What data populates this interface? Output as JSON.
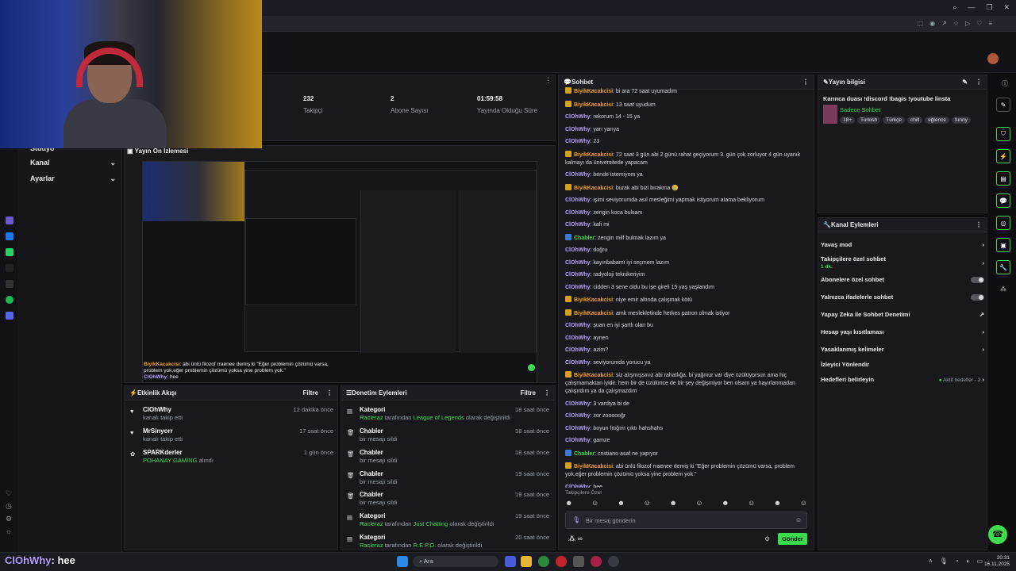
{
  "stats": [
    {
      "value": "232",
      "label": "Takipçi"
    },
    {
      "value": "2",
      "label": "Abone Sayısı"
    },
    {
      "value": "01:59:58",
      "label": "Yayında Olduğu Süre"
    }
  ],
  "sidebar": {
    "studio": "Stüdyo",
    "items": [
      {
        "label": "Kanal"
      },
      {
        "label": "Ayarlar"
      }
    ]
  },
  "preview": {
    "title": "Yayın Ön İzlemesi",
    "overlay_user": "BiyikKacakcisi",
    "overlay_text": ": abi ünlü filozof rraenee demiş ki \"Eğer problemin çözümü varsa, problem yok,eğer problemin çözümü yoksa yine problem yok.\"",
    "overlay_user2": "ClOhWhy",
    "overlay_text2": ": hee"
  },
  "activity": {
    "title": "Etkinlik Akışı",
    "filter": "Filtre",
    "items": [
      {
        "user": "ClOhWhy",
        "desc": "kanalı takip etti",
        "time": "12 dakika önce"
      },
      {
        "user": "MrSinyorr",
        "desc": "kanalı takip etti",
        "time": "17 saat önce"
      },
      {
        "user": "SPARKderler",
        "desc_green": "POHANAY GAMİNG",
        "desc": "alındı",
        "time": "1 gün önce"
      }
    ]
  },
  "moderation": {
    "title": "Denetim Eylemleri",
    "filter": "Filtre",
    "items": [
      {
        "title": "Kategori",
        "by": "Racleraz",
        "mid": "tarafından",
        "target": "League of Legends",
        "end": "olarak değiştirildi",
        "time": "18 saat önce"
      },
      {
        "title": "Chabler",
        "desc": "bir mesajı sildi",
        "time": "18 saat önce"
      },
      {
        "title": "Chabler",
        "desc": "bir mesajı sildi",
        "time": "18 saat önce"
      },
      {
        "title": "Chabler",
        "desc": "bir mesajı sildi",
        "time": "19 saat önce"
      },
      {
        "title": "Chabler",
        "desc": "bir mesajı sildi",
        "time": "19 saat önce"
      },
      {
        "title": "Kategori",
        "by": "Racleraz",
        "mid": "tarafından",
        "target": "Just Chatting",
        "end": "olarak değiştirildi",
        "time": "19 saat önce"
      },
      {
        "title": "Kategori",
        "by": "Racleraz",
        "mid": "tarafından",
        "target": "R.E.P.O.",
        "end": "olarak değiştirildi",
        "time": "20 saat önce"
      }
    ]
  },
  "chat": {
    "title": "Sohbet",
    "messages": [
      {
        "u": "BiyikKacakcisi",
        "c": "o",
        "t": ": bi ara 72 saat uyumadım"
      },
      {
        "u": "BiyikKacakcisi",
        "c": "o",
        "t": ": 13 saat uyudum"
      },
      {
        "u": "ClOhWhy",
        "c": "v",
        "t": ": rekorum 14 - 15 ya"
      },
      {
        "u": "ClOhWhy",
        "c": "v",
        "t": ": yarı yarıya"
      },
      {
        "u": "ClOhWhy",
        "c": "v",
        "t": ": 23"
      },
      {
        "u": "BiyikKacakcisi",
        "c": "o",
        "t": ": 72 saat 3 gün abi 2 günü rahat geçiyorum 3. gün çok zorluyor 4 gün uyanık kalmayı da üniversitede yapacam"
      },
      {
        "u": "ClOhWhy",
        "c": "v",
        "t": ": bende istemiyom ya"
      },
      {
        "u": "BiyikKacakcisi",
        "c": "o",
        "t": ": burak abi bizi bırakma 😢"
      },
      {
        "u": "ClOhWhy",
        "c": "v",
        "t": ": işimi seviyorumda asıl mesleğimi yapmak istiyorum atama bekliyorum"
      },
      {
        "u": "ClOhWhy",
        "c": "v",
        "t": ": zengin koca bulsam"
      },
      {
        "u": "ClOhWhy",
        "c": "v",
        "t": ": kafi mi"
      },
      {
        "u": "Chabler",
        "c": "g",
        "t": ": zengin milf bulmak lazım ya"
      },
      {
        "u": "ClOhWhy",
        "c": "v",
        "t": ": doğru"
      },
      {
        "u": "ClOhWhy",
        "c": "v",
        "t": ": kayınbabamı iyi seçmem lazım"
      },
      {
        "u": "ClOhWhy",
        "c": "v",
        "t": ": radyoloji teknikeriyim"
      },
      {
        "u": "ClOhWhy",
        "c": "v",
        "t": ": cidden 3 sene oldu bu işe gireli 15 yaş yaşlandım"
      },
      {
        "u": "BiyikKacakcisi",
        "c": "o",
        "t": ": niye emir altında çalışmak kötü"
      },
      {
        "u": "BiyikKacakcisi",
        "c": "o",
        "t": ": amk meslekletinde herkes patron olmak istiyor"
      },
      {
        "u": "ClOhWhy",
        "c": "v",
        "t": ": şuan en iyi şartlı olan bu"
      },
      {
        "u": "ClOhWhy",
        "c": "v",
        "t": ": aynen"
      },
      {
        "u": "ClOhWhy",
        "c": "v",
        "t": ": azim?"
      },
      {
        "u": "ClOhWhy",
        "c": "v",
        "t": ": seviyorumda yorucu ya"
      },
      {
        "u": "BiyikKacakcisi",
        "c": "o",
        "t": ": siz alışmışsınız abi rahatlığa. bi yağmur var diye üzülüyorsun ama hiç çalışmamaktan iyidir. hem bir de üzülünce de bir şey değişmiyor ben olsam ya hayırlanmadan çalışırdım ya da çalışmazdım"
      },
      {
        "u": "ClOhWhy",
        "c": "v",
        "t": ": 3 vardiya bi de"
      },
      {
        "u": "ClOhWhy",
        "c": "v",
        "t": ": zor zoooooğr"
      },
      {
        "u": "ClOhWhy",
        "c": "v",
        "t": ": boyun fıtığım çıktı hahshahs"
      },
      {
        "u": "ClOhWhy",
        "c": "v",
        "t": ": gamze"
      },
      {
        "u": "Chabler",
        "c": "g",
        "t": ": cristiano asaf ne yapıyor"
      },
      {
        "u": "BiyikKacakcisi",
        "c": "o",
        "t": ": abi ünlü filozof rraenee demiş ki \"Eğer problemin çözümü varsa, problem yok,eğer problemin çözümü yoksa yine problem yok.\""
      },
      {
        "u": "ClOhWhy",
        "c": "v",
        "t": ": hee"
      }
    ],
    "followers_only": "Takipçilere Özel",
    "input_placeholder": "Bir mesaj gönderin",
    "points": "∞",
    "send": "Gönder"
  },
  "stream_info": {
    "title": "Yayın bilgisi",
    "stream_title": "Karınca duası !discord !bagis !youtube linsta",
    "category": "Sadece Sohbet",
    "tags": [
      "18+",
      "Turkish",
      "Türkçe",
      "chill",
      "eğlence",
      "funny"
    ]
  },
  "channel_actions": {
    "title": "Kanal Eylemleri",
    "slow_mode": "Yavaş mod",
    "followers_chat": "Takipçilere özel sohbet",
    "followers_chat_sub": "1 dk.",
    "subs_chat": "Abonelere özel sohbet",
    "emote_chat": "Yalnızca ifadelerle sohbet",
    "ai_mod": "Yapay Zeka ile Sohbet Denetimi",
    "account_age": "Hesap yaşı kısıtlaması",
    "banned_words": "Yasaklanmış kelimeler",
    "raid": "İzleyici Yönlendir",
    "goals": "Hedefleri belirleyin",
    "goals_status": "Aktif hedefler - 2"
  },
  "overlay_caption": {
    "user": "ClOhWhy",
    "text": ": hee"
  },
  "taskbar": {
    "search": "Ara",
    "time": "20:31",
    "date": "16.11.2025"
  },
  "colors": {
    "accent": "#3ddc4e",
    "bg": "#0e0e10",
    "panel": "#18181d",
    "user_violet": "#b8a2ff",
    "user_orange": "#f0a020"
  }
}
